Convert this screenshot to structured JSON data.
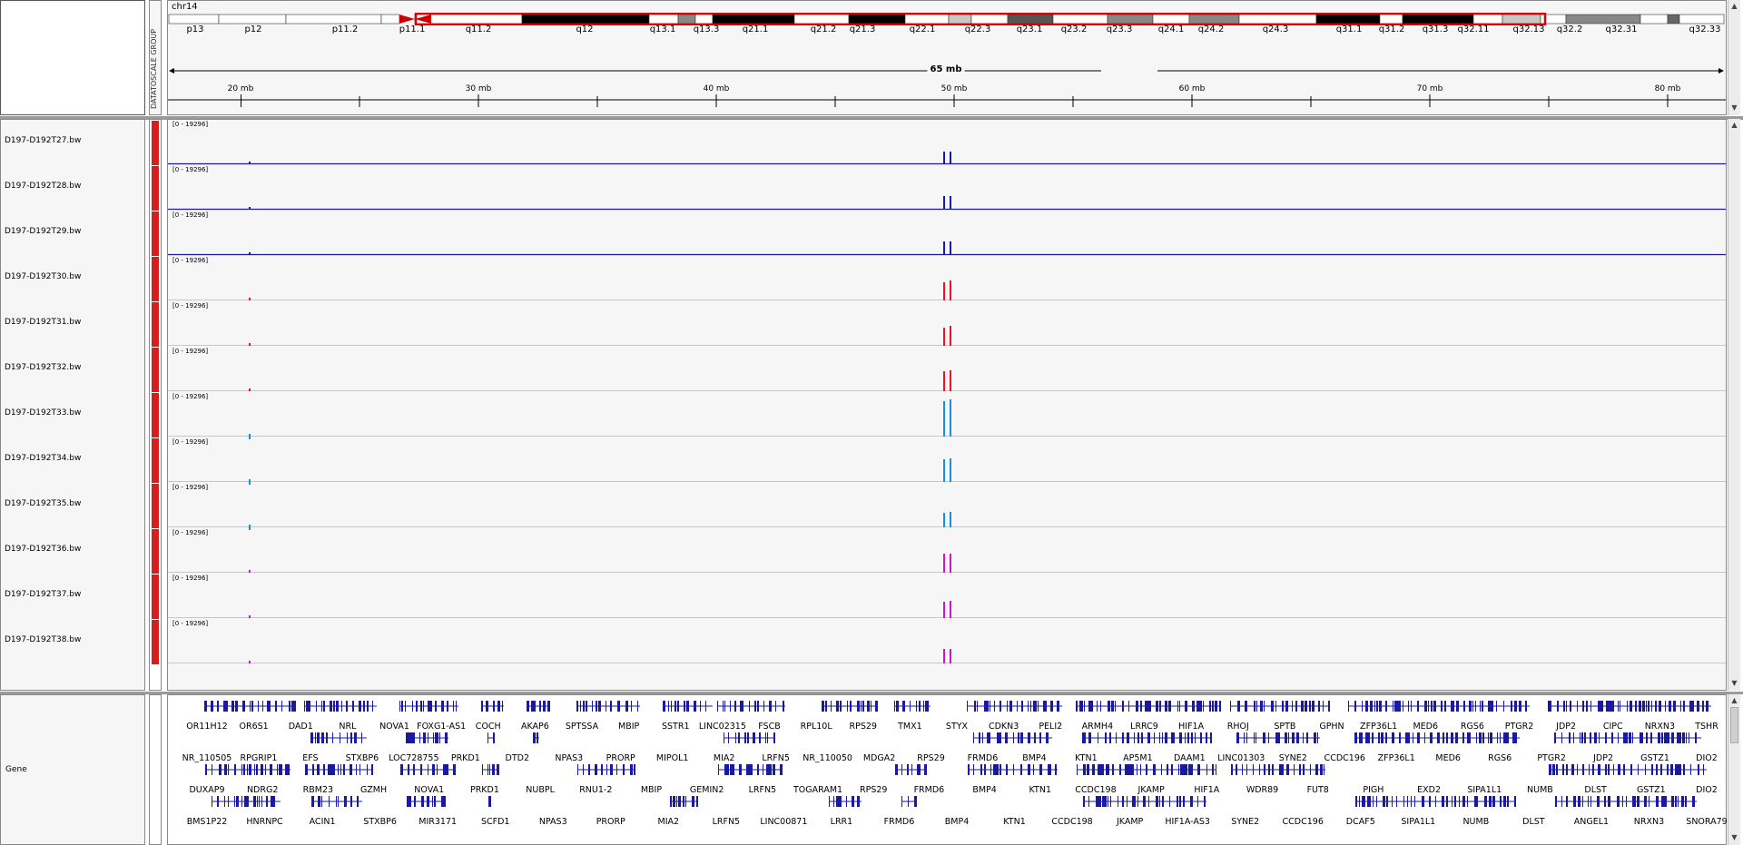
{
  "header": {
    "chromosome": "chr14",
    "attribute_column": "DATATOSCALE GROUP",
    "ruler_span": "65 mb",
    "ideogram_bands": [
      "p13",
      "p12",
      "p11.2",
      "p11.1",
      "q11.2",
      "q12",
      "q13.1",
      "q13.3",
      "q21.1",
      "q21.2",
      "q21.3",
      "q22.1",
      "q22.3",
      "q23.1",
      "q23.2",
      "q23.3",
      "q24.1",
      "q24.2",
      "q24.3",
      "q31.1",
      "q31.2",
      "q31.3",
      "q32.11",
      "q32.13",
      "q32.2",
      "q32.31",
      "q32.33"
    ],
    "ruler_ticks": [
      "20 mb",
      "30 mb",
      "40 mb",
      "50 mb",
      "60 mb",
      "70 mb",
      "80 mb"
    ]
  },
  "tracks": [
    {
      "name": "D197-D192T27.bw",
      "range": "[0 - 19296]",
      "color": "#1a1aa0"
    },
    {
      "name": "D197-D192T28.bw",
      "range": "[0 - 19296]",
      "color": "#1a1aa0"
    },
    {
      "name": "D197-D192T29.bw",
      "range": "[0 - 19296]",
      "color": "#1a1aa0"
    },
    {
      "name": "D197-D192T30.bw",
      "range": "[0 - 19296]",
      "color": "#e0182a"
    },
    {
      "name": "D197-D192T31.bw",
      "range": "[0 - 19296]",
      "color": "#e0182a"
    },
    {
      "name": "D197-D192T32.bw",
      "range": "[0 - 19296]",
      "color": "#e0182a"
    },
    {
      "name": "D197-D192T33.bw",
      "range": "[0 - 19296]",
      "color": "#1b8fd6"
    },
    {
      "name": "D197-D192T34.bw",
      "range": "[0 - 19296]",
      "color": "#1b8fd6"
    },
    {
      "name": "D197-D192T35.bw",
      "range": "[0 - 19296]",
      "color": "#1b8fd6"
    },
    {
      "name": "D197-D192T36.bw",
      "range": "[0 - 19296]",
      "color": "#c21cc2"
    },
    {
      "name": "D197-D192T37.bw",
      "range": "[0 - 19296]",
      "color": "#c21cc2"
    },
    {
      "name": "D197-D192T38.bw",
      "range": "[0 - 19296]",
      "color": "#c21cc2"
    }
  ],
  "gene_track": {
    "name": "Gene",
    "rows": [
      [
        "OR11H12",
        "OR6S1",
        "DAD1",
        "NRL",
        "NOVA1",
        "FOXG1-AS1",
        "COCH",
        "AKAP6",
        "SPTSSA",
        "MBIP",
        "SSTR1",
        "LINC02315",
        "FSCB",
        "RPL10L",
        "RPS29",
        "TMX1",
        "STYX",
        "CDKN3",
        "PELI2",
        "ARMH4",
        "LRRC9",
        "HIF1A",
        "RHOJ",
        "SPTB",
        "GPHN",
        "ZFP36L1",
        "MED6",
        "RGS6",
        "PTGR2",
        "JDP2",
        "CIPC",
        "NRXN3",
        "TSHR"
      ],
      [
        "NR_110505",
        "RPGRIP1",
        "EFS",
        "STXBP6",
        "LOC728755",
        "PRKD1",
        "DTD2",
        "NPAS3",
        "PRORP",
        "MIPOL1",
        "MIA2",
        "LRFN5",
        "NR_110050",
        "MDGA2",
        "RPS29",
        "FRMD6",
        "BMP4",
        "KTN1",
        "AP5M1",
        "DAAM1",
        "LINC01303",
        "SYNE2",
        "CCDC196",
        "ZFP36L1",
        "MED6",
        "RGS6",
        "PTGR2",
        "JDP2",
        "GSTZ1",
        "DIO2"
      ],
      [
        "DUXAP9",
        "NDRG2",
        "RBM23",
        "GZMH",
        "NOVA1",
        "PRKD1",
        "NUBPL",
        "RNU1-2",
        "MBIP",
        "GEMIN2",
        "LRFN5",
        "TOGARAM1",
        "RPS29",
        "FRMD6",
        "BMP4",
        "KTN1",
        "CCDC198",
        "JKAMP",
        "HIF1A",
        "WDR89",
        "FUT8",
        "PIGH",
        "EXD2",
        "SIPA1L1",
        "NUMB",
        "DLST",
        "GSTZ1",
        "DIO2"
      ],
      [
        "BMS1P22",
        "HNRNPC",
        "ACIN1",
        "STXBP6",
        "MIR3171",
        "SCFD1",
        "NPAS3",
        "PRORP",
        "MIA2",
        "LRFN5",
        "LINC00871",
        "LRR1",
        "FRMD6",
        "BMP4",
        "KTN1",
        "CCDC198",
        "JKAMP",
        "HIF1A-AS3",
        "SYNE2",
        "CCDC196",
        "DCAF5",
        "SIPA1L1",
        "NUMB",
        "DLST",
        "ANGEL1",
        "NRXN3",
        "SNORA79"
      ]
    ]
  },
  "colors": {
    "panel_bg": "#f6f6f6",
    "attr_red": "#d21f1f",
    "gene_blue": "#1a1aa0",
    "roi_red": "#e00000"
  }
}
